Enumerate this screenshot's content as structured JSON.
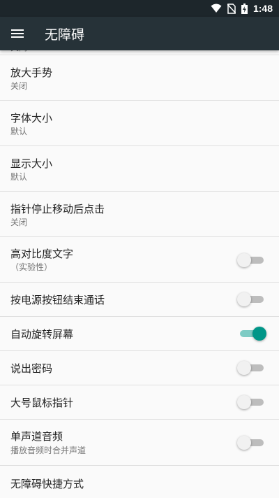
{
  "status_bar": {
    "time": "1:48",
    "icons": [
      "wifi-icon",
      "no-sim-icon",
      "battery-charging-icon"
    ]
  },
  "toolbar": {
    "title": "无障碍",
    "menu_icon": "menu-icon"
  },
  "settings": {
    "partial_summary": "关闭",
    "magnification": {
      "title": "放大手势",
      "summary": "关闭"
    },
    "font_size": {
      "title": "字体大小",
      "summary": "默认"
    },
    "display_size": {
      "title": "显示大小",
      "summary": "默认"
    },
    "click_after_pointer_stops": {
      "title": "指针停止移动后点击",
      "summary": "关闭"
    },
    "high_contrast_text": {
      "title": "高对比度文字",
      "summary": "（实验性）",
      "checked": false
    },
    "power_button_ends_call": {
      "title": "按电源按钮结束通话",
      "checked": false
    },
    "auto_rotate_screen": {
      "title": "自动旋转屏幕",
      "checked": true
    },
    "speak_passwords": {
      "title": "说出密码",
      "checked": false
    },
    "large_mouse_pointer": {
      "title": "大号鼠标指针",
      "checked": false
    },
    "mono_audio": {
      "title": "单声道音频",
      "summary": "播放音频时合并声道",
      "checked": false
    },
    "accessibility_shortcut": {
      "title": "无障碍快捷方式"
    }
  },
  "colors": {
    "toolbar": "#263238",
    "status_bar": "#1d262b",
    "accent": "#009688"
  }
}
